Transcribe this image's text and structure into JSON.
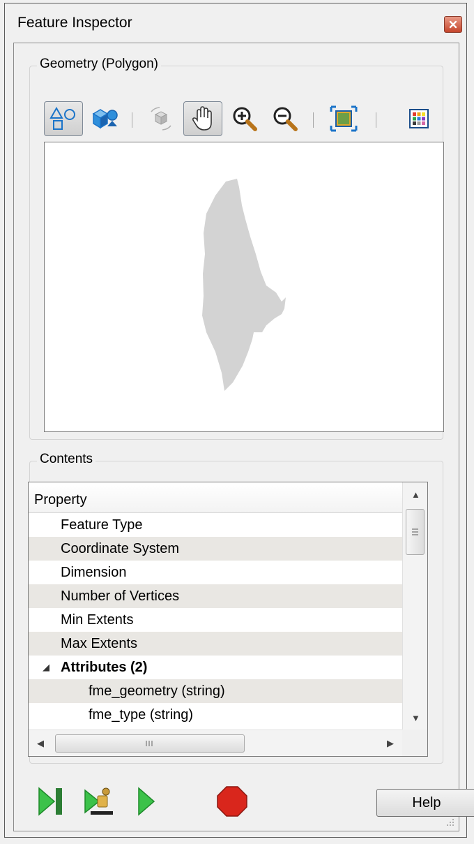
{
  "window": {
    "title": "Feature Inspector"
  },
  "geometry": {
    "group_label": "Geometry (Polygon)",
    "toolbar": [
      {
        "name": "geometry-view-2d-button",
        "icon": "shapes-2d-icon",
        "active": true
      },
      {
        "name": "geometry-view-3d-button",
        "icon": "shapes-3d-icon",
        "active": false
      },
      {
        "name": "orbit-button",
        "icon": "orbit-cube-icon",
        "active": false,
        "disabled": true
      },
      {
        "name": "pan-button",
        "icon": "hand-icon",
        "active": true
      },
      {
        "name": "zoom-in-button",
        "icon": "zoom-in-icon",
        "active": false
      },
      {
        "name": "zoom-out-button",
        "icon": "zoom-out-icon",
        "active": false
      },
      {
        "name": "zoom-extents-button",
        "icon": "zoom-extents-icon",
        "active": false
      },
      {
        "name": "color-palette-button",
        "icon": "color-grid-icon",
        "active": false
      }
    ],
    "shape_color": "#d3d3d3"
  },
  "contents": {
    "group_label": "Contents",
    "column_header": "Property",
    "rows": [
      {
        "label": "Feature Type",
        "indent": 1,
        "bold": false,
        "expander": ""
      },
      {
        "label": "Coordinate System",
        "indent": 1,
        "bold": false,
        "expander": ""
      },
      {
        "label": "Dimension",
        "indent": 1,
        "bold": false,
        "expander": ""
      },
      {
        "label": "Number of Vertices",
        "indent": 1,
        "bold": false,
        "expander": ""
      },
      {
        "label": "Min Extents",
        "indent": 1,
        "bold": false,
        "expander": ""
      },
      {
        "label": "Max Extents",
        "indent": 1,
        "bold": false,
        "expander": ""
      },
      {
        "label": "Attributes (2)",
        "indent": 1,
        "bold": true,
        "expander": "◢"
      },
      {
        "label": "fme_geometry (string)",
        "indent": 2,
        "bold": false,
        "expander": ""
      },
      {
        "label": "fme_type (string)",
        "indent": 2,
        "bold": false,
        "expander": ""
      }
    ]
  },
  "bottom": {
    "help_label": "Help",
    "icons": [
      "step-icon",
      "run-to-breakpoint-icon",
      "continue-icon",
      "stop-icon"
    ]
  },
  "colors": {
    "accent_green": "#2fae3a",
    "stop_red": "#d9261c"
  }
}
